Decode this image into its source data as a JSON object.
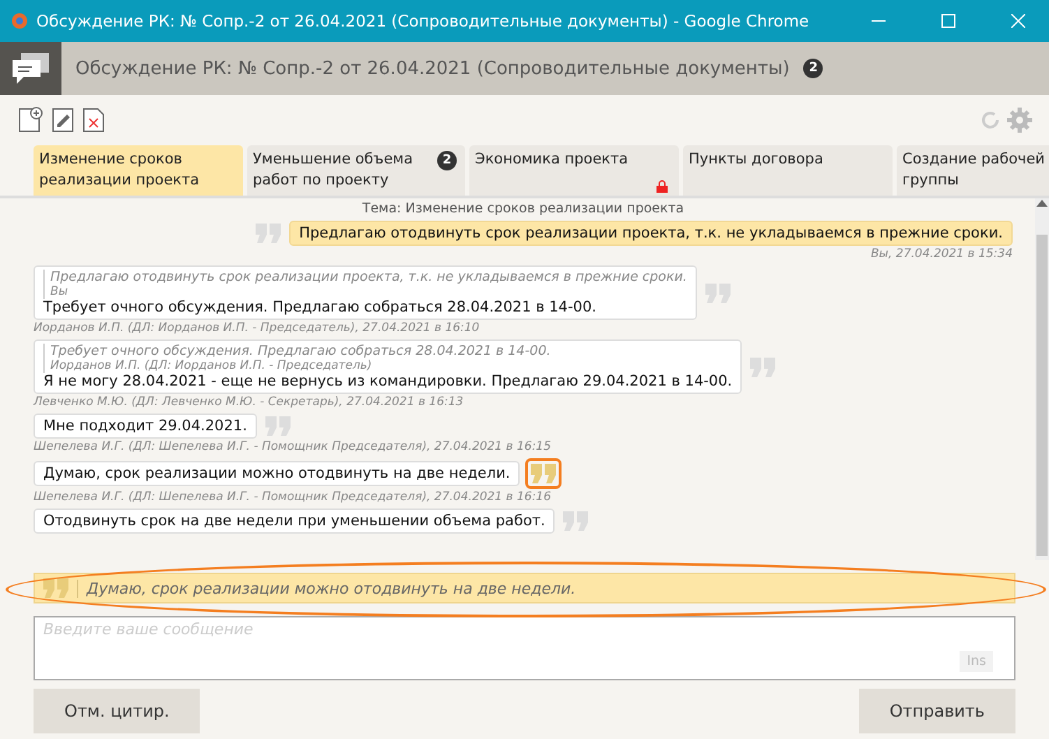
{
  "window": {
    "title": "Обсуждение РК: № Сопр.-2 от 26.04.2021 (Сопроводительные документы) - Google Chrome"
  },
  "header": {
    "title": "Обсуждение РК: № Сопр.-2 от 26.04.2021 (Сопроводительные документы)",
    "badge": "2"
  },
  "tabs": [
    {
      "label": "Изменение сроков реализации проекта",
      "selected": true
    },
    {
      "label": "Уменьшение объема работ по проекту",
      "selected": false,
      "badge": "2"
    },
    {
      "label": "Экономика проекта",
      "selected": false,
      "locked": true
    },
    {
      "label": "Пункты договора",
      "selected": false
    },
    {
      "label": "Создание рабочей группы",
      "selected": false
    }
  ],
  "chat": {
    "topic": "Тема: Изменение сроков реализации проекта",
    "messages": [
      {
        "kind": "mine",
        "text": "Предлагаю отодвинуть срок реализации проекта, т.к. не укладываемся в прежние сроки.",
        "meta": "Вы, 27.04.2021 в 15:34",
        "highlighted": false
      },
      {
        "kind": "other",
        "quote": {
          "text": "Предлагаю отодвинуть срок реализации проекта, т.к. не укладываемся в прежние сроки.",
          "author": "Вы"
        },
        "text": "Требует очного обсуждения. Предлагаю собраться 28.04.2021 в 14-00.",
        "meta": "Иорданов И.П. (ДЛ: Иорданов И.П. - Председатель), 27.04.2021 в 16:10",
        "highlighted": false
      },
      {
        "kind": "other",
        "quote": {
          "text": "Требует очного обсуждения. Предлагаю собраться 28.04.2021 в 14-00.",
          "author": "Иорданов И.П. (ДЛ: Иорданов И.П. - Председатель)"
        },
        "text": "Я не могу 28.04.2021 - еще не вернусь из командировки. Предлагаю 29.04.2021 в 14-00.",
        "meta": "Левченко М.Ю. (ДЛ: Левченко М.Ю. - Секретарь), 27.04.2021 в 16:13",
        "highlighted": false
      },
      {
        "kind": "other",
        "text": "Мне подходит 29.04.2021.",
        "meta": "Шепелева И.Г. (ДЛ: Шепелева И.Г. - Помощник Председателя), 27.04.2021 в 16:15",
        "highlighted": false
      },
      {
        "kind": "other",
        "text": "Думаю, срок реализации можно отодвинуть на две недели.",
        "meta": "Шепелева И.Г. (ДЛ: Шепелева И.Г. - Помощник Председателя), 27.04.2021 в 16:16",
        "highlighted": true
      },
      {
        "kind": "other",
        "text": "Отодвинуть срок на две недели при уменьшении объема работ.",
        "highlighted": false
      }
    ]
  },
  "reply": {
    "quote": "Думаю, срок реализации можно отодвинуть на две недели.",
    "highlighted": true,
    "placeholder": "Введите ваше сообщение",
    "ins": "Ins"
  },
  "buttons": {
    "cancel_quote": "Отм. цитир.",
    "send": "Отправить"
  }
}
